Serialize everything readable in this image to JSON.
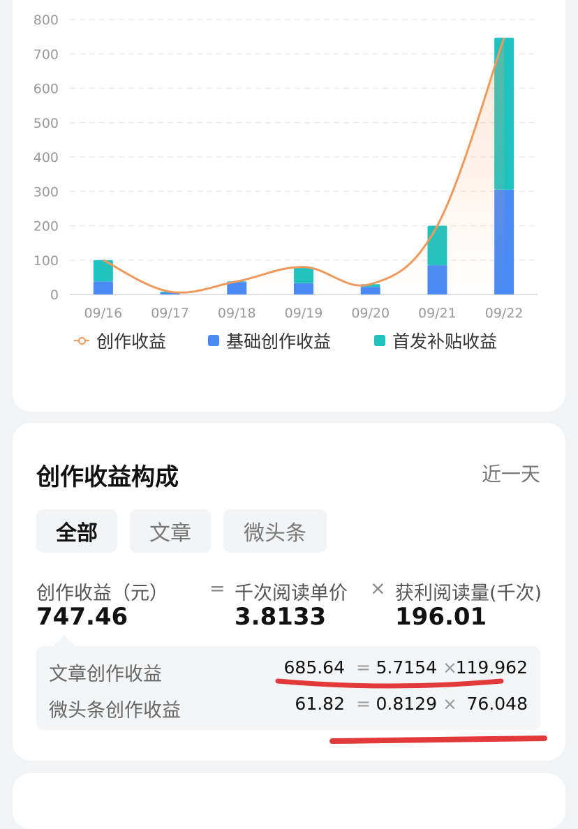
{
  "chart_data": {
    "type": "bar",
    "categories": [
      "09/16",
      "09/17",
      "09/18",
      "09/19",
      "09/20",
      "09/21",
      "09/22"
    ],
    "series": [
      {
        "name": "基础创作收益",
        "kind": "bar",
        "stack": "income",
        "color": "#4a8af4",
        "values": [
          38,
          5,
          36,
          33,
          22,
          85,
          305
        ]
      },
      {
        "name": "首发补贴收益",
        "kind": "bar",
        "stack": "income",
        "color": "#1ec3c0",
        "values": [
          62,
          3,
          2,
          47,
          8,
          115,
          442
        ]
      },
      {
        "name": "创作收益",
        "kind": "line",
        "color": "#ef9a5c",
        "values": [
          100,
          8,
          38,
          80,
          30,
          200,
          747
        ]
      }
    ],
    "yticks": [
      0,
      100,
      200,
      300,
      400,
      500,
      600,
      700,
      800
    ],
    "ylim": [
      0,
      800
    ],
    "grid": true,
    "legend_position": "bottom"
  },
  "legend": [
    {
      "label": "创作收益",
      "marker": "line-circle",
      "color": "#ef9a5c"
    },
    {
      "label": "基础创作收益",
      "marker": "square",
      "color": "#4a8af4"
    },
    {
      "label": "首发补贴收益",
      "marker": "square",
      "color": "#1ec3c0"
    }
  ],
  "composition": {
    "title": "创作收益构成",
    "range_label": "近一天",
    "tabs": [
      "全部",
      "文章",
      "微头条"
    ],
    "active_tab": "全部",
    "formula": {
      "income_label": "创作收益（元）",
      "income_value": "747.46",
      "eq": "=",
      "price_label": "千次阅读单价",
      "price_value": "3.8133",
      "times": "×",
      "reads_label": "获利阅读量(千次)",
      "reads_value": "196.01"
    },
    "rows": [
      {
        "label": "文章创作收益",
        "income": "685.64",
        "eq": "=",
        "price": "5.7154",
        "times": "×",
        "reads": "119.962"
      },
      {
        "label": "微头条创作收益",
        "income": "61.82",
        "eq": "=",
        "price": "0.8129",
        "times": "×",
        "reads": "76.048"
      }
    ]
  }
}
